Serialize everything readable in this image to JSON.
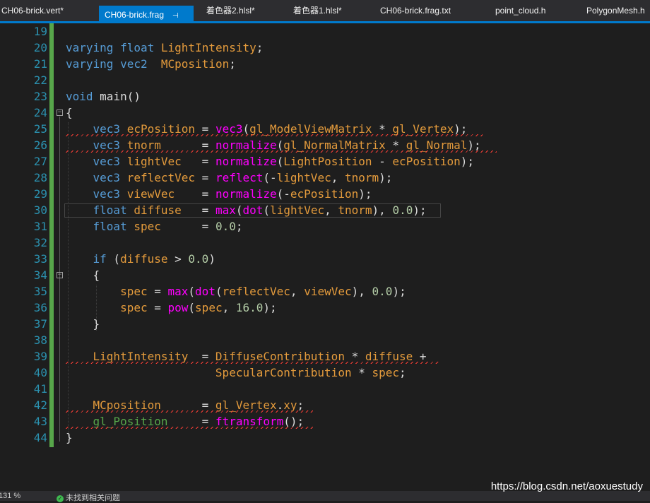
{
  "tabs": [
    {
      "label": "CH06-brick.vert*"
    },
    {
      "label": "CH06-brick.frag",
      "pin": "⊣"
    },
    {
      "label": "着色器2.hlsl*"
    },
    {
      "label": "着色器1.hlsl*"
    },
    {
      "label": "CH06-brick.frag.txt"
    },
    {
      "label": "point_cloud.h"
    },
    {
      "label": "PolygonMesh.h"
    }
  ],
  "lines": [
    "19",
    "20",
    "21",
    "22",
    "23",
    "24",
    "25",
    "26",
    "27",
    "28",
    "29",
    "30",
    "31",
    "32",
    "33",
    "34",
    "35",
    "36",
    "37",
    "38",
    "39",
    "40",
    "41",
    "42",
    "43",
    "44"
  ],
  "status": {
    "zoom": "131 %",
    "issues": "未找到相关问题"
  },
  "watermark": "https://blog.csdn.net/aoxuestudy",
  "colors": {
    "accent": "#007acc",
    "background": "#1e1e1e"
  }
}
